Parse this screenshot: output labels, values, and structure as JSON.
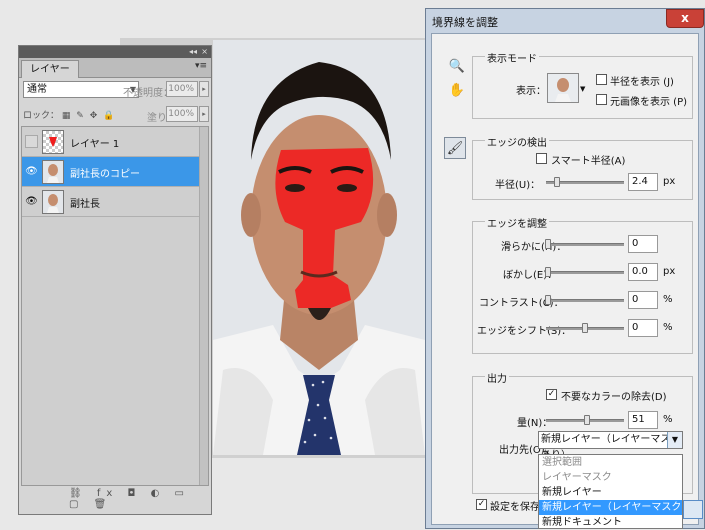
{
  "layers_panel": {
    "collapse_glyph": "◂◂",
    "close_glyph": "×",
    "tab_label": "レイヤー",
    "menu_glyph": "▾≡",
    "blend_mode": "通常",
    "opacity_label": "不透明度：",
    "opacity_value": "100%",
    "lock_label": "ロック：",
    "fill_label": "塗り：",
    "fill_value": "100%",
    "layers": [
      {
        "name": "レイヤー 1",
        "visible": false,
        "selected": false
      },
      {
        "name": "副社長のコピー",
        "visible": true,
        "selected": true
      },
      {
        "name": "副社長",
        "visible": true,
        "selected": false
      }
    ],
    "bottom_icons": "⛓ fx ◘ ◐ ▭ ▢ 🗑"
  },
  "dialog": {
    "title": "境界線を調整",
    "close_glyph": "x",
    "view_mode": {
      "group": "表示モード",
      "view_label": "表示：",
      "show_radius": "半径を表示 (J)",
      "show_original": "元画像を表示 (P)"
    },
    "edge_detection": {
      "group": "エッジの検出",
      "smart_radius": "スマート半径(A)",
      "radius_label": "半径(U)：",
      "radius_value": "2.4",
      "radius_unit": "px"
    },
    "adjust_edge": {
      "group": "エッジを調整",
      "smooth_label": "滑らかに(H)：",
      "smooth_value": "0",
      "feather_label": "ぼかし(E)：",
      "feather_value": "0.0",
      "feather_unit": "px",
      "contrast_label": "コントラスト(C)：",
      "contrast_value": "0",
      "contrast_unit": "%",
      "shift_label": "エッジをシフト(S)：",
      "shift_value": "0",
      "shift_unit": "%"
    },
    "output": {
      "group": "出力",
      "decontaminate": "不要なカラーの除去(D)",
      "amount_label": "量(N)：",
      "amount_value": "51",
      "amount_unit": "%",
      "output_to_label": "出力先(O)：",
      "output_to_value": "新規レイヤー（レイヤーマスクあり）",
      "options": [
        {
          "label": "選択範囲",
          "disabled": true
        },
        {
          "label": "レイヤーマスク",
          "disabled": true
        },
        {
          "label": "新規レイヤー",
          "disabled": false
        },
        {
          "label": "新規レイヤー（レイヤーマスクあり）",
          "disabled": false,
          "highlighted": true
        },
        {
          "label": "新規ドキュメント",
          "disabled": false
        }
      ]
    },
    "remember_settings": "設定を保存(T)",
    "zoom_icon": "🔍",
    "hand_icon": "✋",
    "brush_icon": "🖌"
  },
  "colors": {
    "selection_blue": "#3b97e8",
    "mask_red": "#f01e1e",
    "dialog_frame": "#c7d3e2",
    "close_red": "#c94137"
  }
}
